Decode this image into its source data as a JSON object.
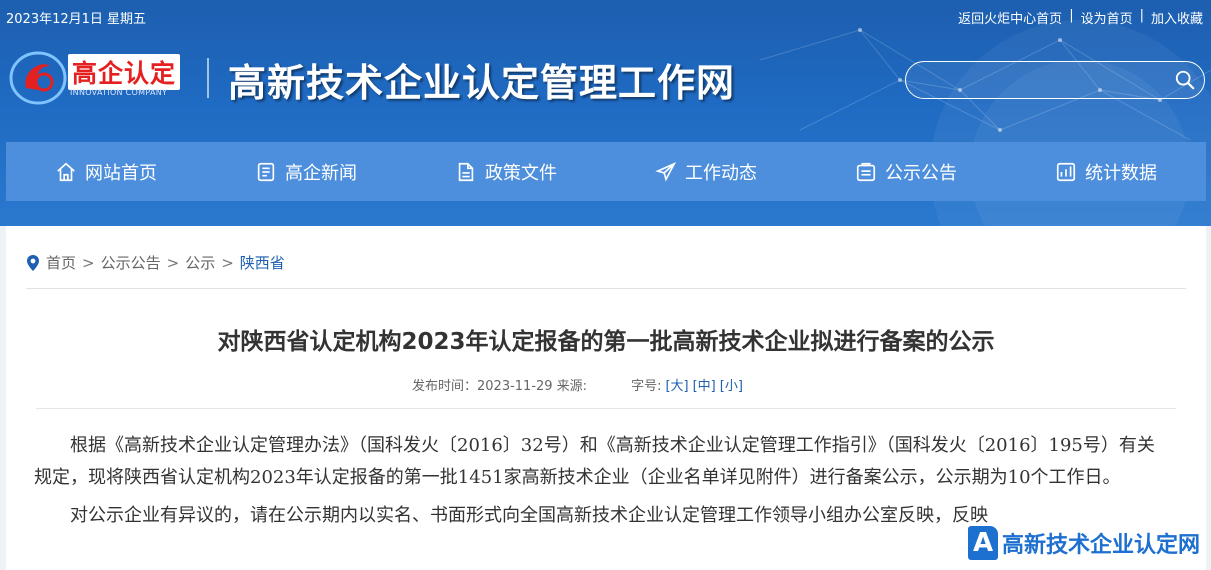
{
  "topbar": {
    "date": "2023年12月1日 星期五",
    "links": [
      "返回火炬中心首页",
      "设为首页",
      "加入收藏"
    ],
    "separator": "|"
  },
  "logo": {
    "cn": "高企认定",
    "en": "INNOVATION COMPANY"
  },
  "site_title": "高新技术企业认定管理工作网",
  "search": {
    "value": "",
    "placeholder": "",
    "icon": "search-icon"
  },
  "nav": [
    {
      "label": "网站首页",
      "icon": "home-icon"
    },
    {
      "label": "高企新闻",
      "icon": "news-icon"
    },
    {
      "label": "政策文件",
      "icon": "document-icon"
    },
    {
      "label": "工作动态",
      "icon": "paper-plane-icon"
    },
    {
      "label": "公示公告",
      "icon": "notice-icon"
    },
    {
      "label": "统计数据",
      "icon": "chart-icon"
    }
  ],
  "breadcrumb": {
    "items": [
      "首页",
      "公示公告",
      "公示"
    ],
    "current": "陕西省",
    "sep": ">"
  },
  "article": {
    "title": "对陕西省认定机构2023年认定报备的第一批高新技术企业拟进行备案的公示",
    "meta_prefix": "发布时间：2023-11-29 来源:",
    "font_label": "字号:",
    "font_sizes": [
      "[大]",
      "[中]",
      "[小]"
    ],
    "paragraph1": "根据《高新技术企业认定管理办法》（国科发火〔2016〕32号）和《高新技术企业认定管理工作指引》（国科发火〔2016〕195号）有关规定，现将陕西省认定机构2023年认定报备的第一批1451家高新技术企业（企业名单详见附件）进行备案公示，公示期为10个工作日。",
    "paragraph2": "对公示企业有异议的，请在公示期内以实名、书面形式向全国高新技术企业认定管理工作领导小组办公室反映，反映"
  },
  "watermark": {
    "letter": "A",
    "text": "高新技术企业认定网"
  },
  "colors": {
    "header": "#1f6ac2",
    "nav": "#4d8fdc",
    "link": "#1d5fb0",
    "logo_red": "#e52020"
  }
}
